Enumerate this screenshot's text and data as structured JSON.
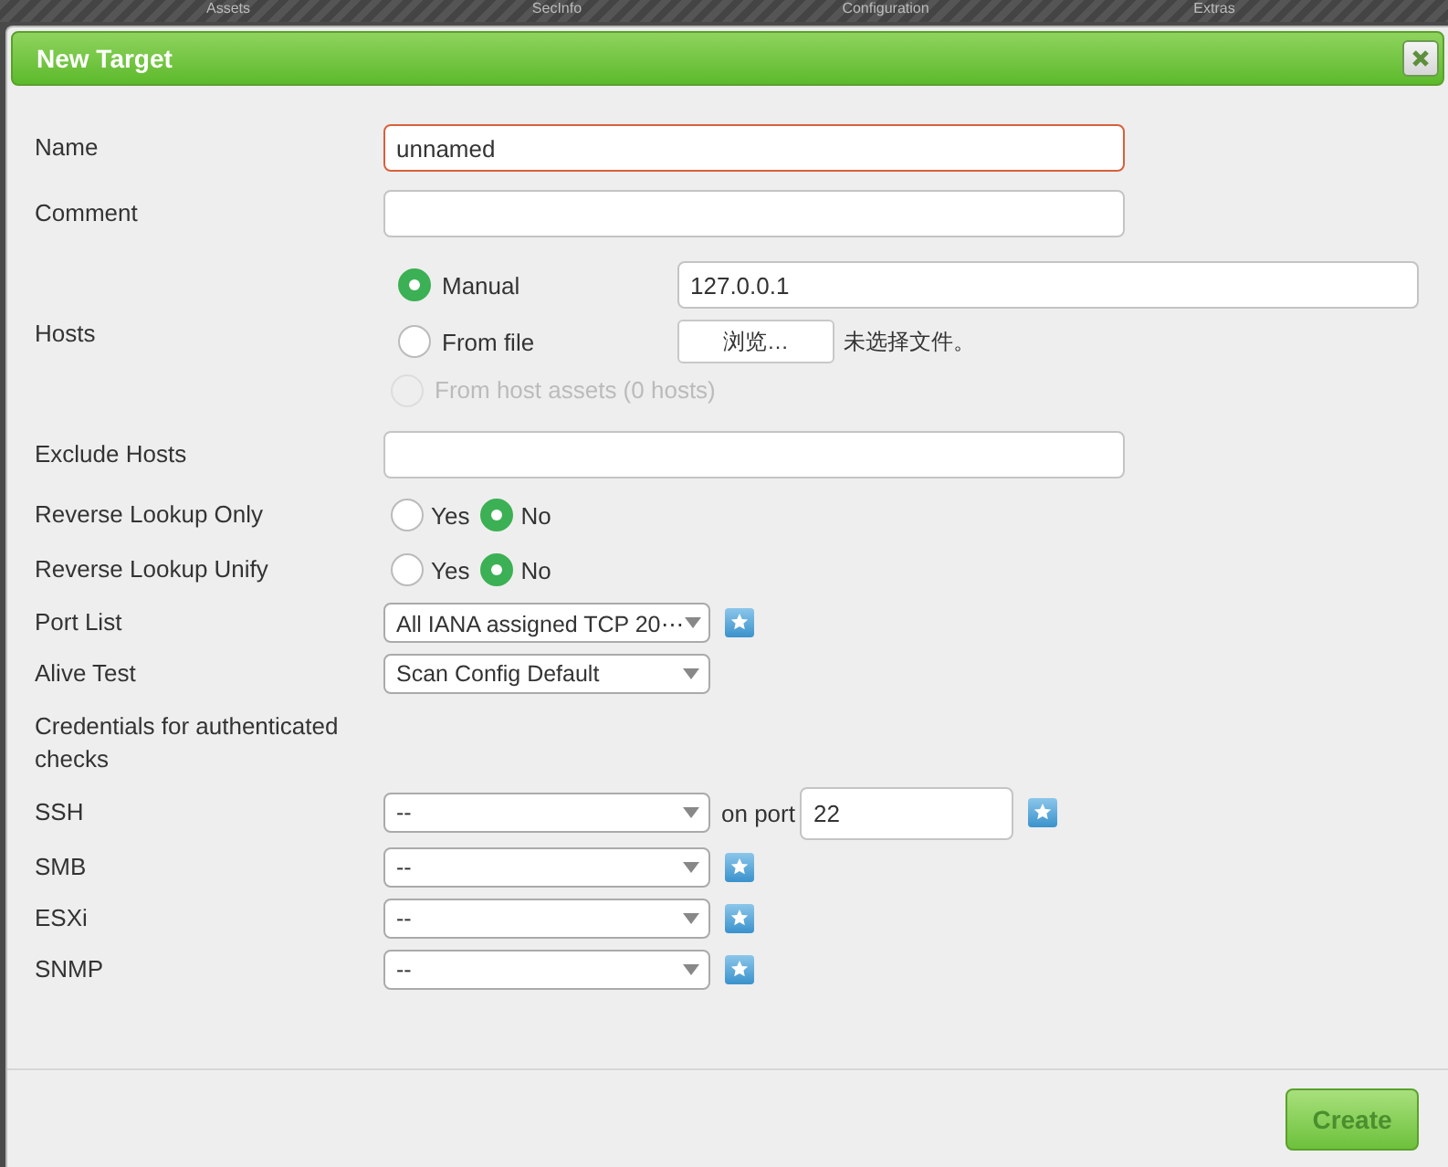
{
  "background_nav": [
    "Assets",
    "SecInfo",
    "Configuration",
    "Extras"
  ],
  "dialog": {
    "title": "New Target",
    "fields": [
      {
        "kind": "text",
        "label": "Name",
        "value": "unnamed",
        "highlighted": true
      },
      {
        "kind": "text",
        "label": "Comment",
        "highlighted": false
      },
      {
        "kind": "hosts",
        "label": "Hosts",
        "options": [
          {
            "label": "Manual",
            "selected": true,
            "disabled": false,
            "input": {
              "kind": "text",
              "value": "127.0.0.1"
            }
          },
          {
            "label": "From file",
            "selected": false,
            "disabled": false,
            "input": {
              "kind": "file",
              "button": "浏览…",
              "status": "未选择文件。"
            }
          },
          {
            "label": "From host assets (0 hosts)",
            "selected": false,
            "disabled": true
          }
        ]
      },
      {
        "kind": "text",
        "label": "Exclude Hosts",
        "highlighted": false
      },
      {
        "kind": "radio",
        "label": "Reverse Lookup Only",
        "options": [
          {
            "label": "Yes",
            "selected": false
          },
          {
            "label": "No",
            "selected": true
          }
        ]
      },
      {
        "kind": "radio",
        "label": "Reverse Lookup Unify",
        "options": [
          {
            "label": "Yes",
            "selected": false
          },
          {
            "label": "No",
            "selected": true
          }
        ]
      },
      {
        "kind": "select",
        "label": "Port List",
        "value": "All IANA assigned TCP 20⋯",
        "new_button": true
      },
      {
        "kind": "select",
        "label": "Alive Test",
        "value": "Scan Config Default",
        "new_button": false
      },
      {
        "kind": "heading",
        "label": "Credentials for authenticated checks"
      },
      {
        "kind": "select",
        "label": "SSH",
        "value": "--",
        "new_button": true,
        "port": {
          "label": "on port",
          "value": "22"
        }
      },
      {
        "kind": "select",
        "label": "SMB",
        "value": "--",
        "new_button": true
      },
      {
        "kind": "select",
        "label": "ESXi",
        "value": "--",
        "new_button": true
      },
      {
        "kind": "select",
        "label": "SNMP",
        "value": "--",
        "new_button": true
      }
    ],
    "create_button": "Create"
  }
}
